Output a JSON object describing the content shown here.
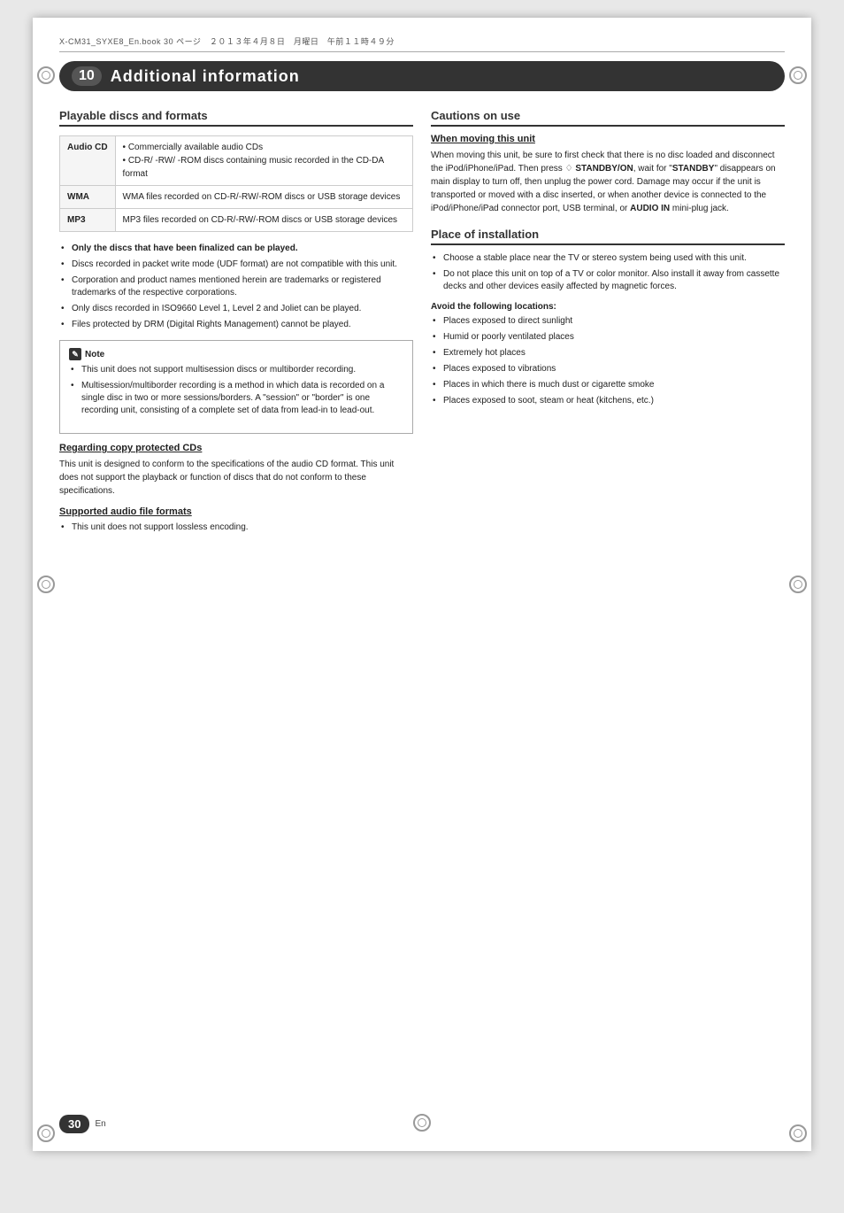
{
  "page": {
    "number": "30",
    "lang": "En",
    "file_info": "X-CM31_SYXE8_En.book  30 ページ　２０１３年４月８日　月曜日　午前１１時４９分"
  },
  "chapter": {
    "number": "10",
    "title": "Additional information"
  },
  "playable_section": {
    "title": "Playable discs and formats",
    "table": [
      {
        "label": "Audio CD",
        "desc_line1": "• Commercially available audio CDs",
        "desc_line2": "• CD-R/ -RW/ -ROM discs containing music recorded in the CD-DA format"
      },
      {
        "label": "WMA",
        "desc_line1": "WMA files recorded on CD-R/-RW/-ROM discs or USB storage devices"
      },
      {
        "label": "MP3",
        "desc_line1": "MP3 files recorded on CD-R/-RW/-ROM discs or USB storage devices"
      }
    ],
    "bullets": [
      "Only the discs that have been finalized can be played.",
      "Discs recorded in packet write mode (UDF format) are not compatible with this unit.",
      "Corporation and product names mentioned herein are trademarks or registered trademarks of the respective corporations.",
      "Only discs recorded in ISO9660 Level 1, Level 2 and Joliet can be played.",
      "Files protected by DRM (Digital Rights Management) cannot be played."
    ],
    "note_title": "Note",
    "note_bullets": [
      "This unit does not support multisession discs or multiborder recording.",
      "Multisession/multiborder recording is a method in which data is recorded on a single disc in two or more sessions/borders. A \"session\" or \"border\" is one recording unit, consisting of a complete set of data from lead-in to lead-out."
    ],
    "copy_protected_title": "Regarding copy protected CDs",
    "copy_protected_text": "This unit is designed to conform to the specifications of the audio CD format. This unit does not support the playback or function of discs that do not conform to these specifications.",
    "supported_audio_title": "Supported audio file formats",
    "supported_audio_bullets": [
      "This unit does not support lossless encoding."
    ]
  },
  "cautions_section": {
    "title": "Cautions on use",
    "moving_title": "When moving this unit",
    "moving_text": "When moving this unit, be sure to first check that there is no disc loaded and disconnect the iPod/iPhone/iPad. Then press",
    "moving_text2": "STANDBY/ON",
    "moving_text3": ", wait for \"",
    "moving_text4": "STANDBY",
    "moving_text5": "\" disappears on main display to turn off, then unplug the power cord. Damage may occur if the unit is transported or moved with a disc inserted, or when another device is connected to the iPod/iPhone/iPad connector port, USB terminal, or",
    "moving_text6": "AUDIO IN",
    "moving_text7": "mini-plug jack.",
    "installation_title": "Place of installation",
    "installation_bullets": [
      "Choose a stable place near the TV or stereo system being used with this unit.",
      "Do not place this unit on top of a TV or color monitor. Also install it away from cassette decks and other devices easily affected by magnetic forces."
    ],
    "avoid_title": "Avoid the following locations:",
    "avoid_bullets": [
      "Places exposed to direct sunlight",
      "Humid or poorly ventilated places",
      "Extremely hot places",
      "Places exposed to vibrations",
      "Places in which there is much dust or cigarette smoke",
      "Places exposed to soot, steam or heat (kitchens, etc.)"
    ]
  }
}
